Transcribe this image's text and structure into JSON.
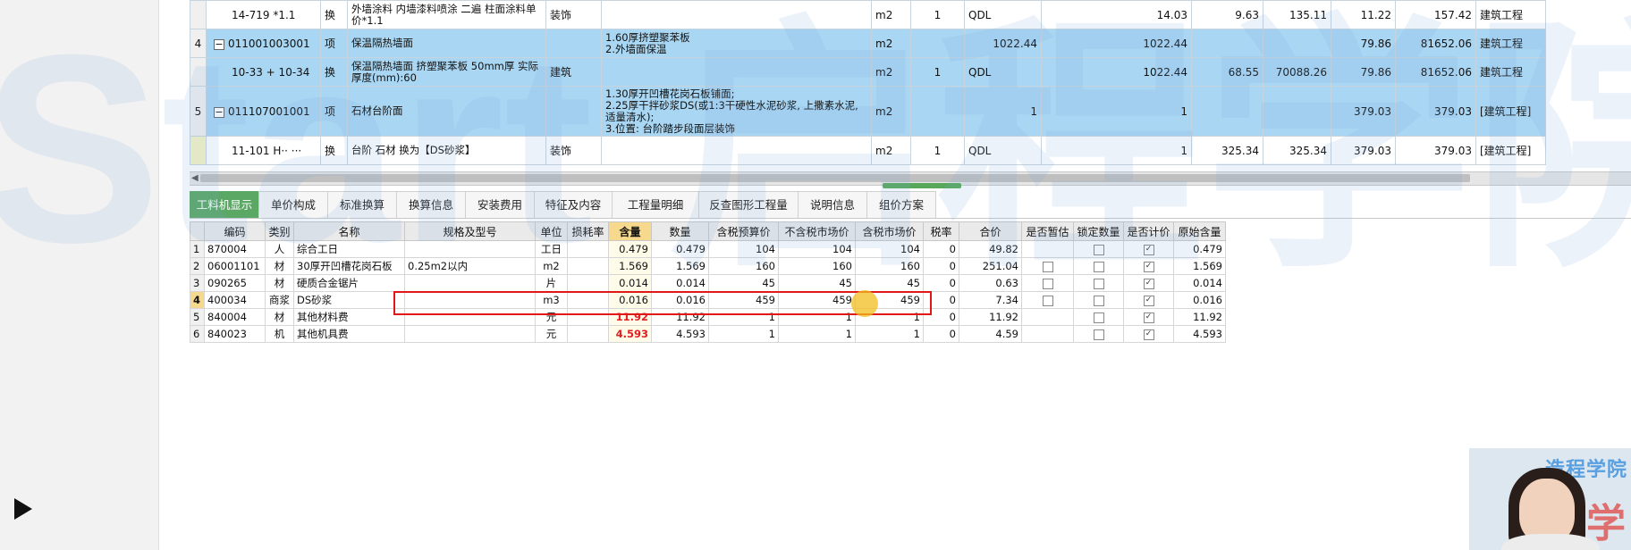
{
  "top_table": {
    "rows": [
      {
        "rowno": "",
        "code": "14-719 *1.1",
        "type": "换",
        "name": "外墙涂料 内墙漆料喷涂 二遍 柱面涂料单价*1.1",
        "profession": "装饰",
        "feature": "",
        "unit": "m2",
        "qty_ratio": "1",
        "expr": "QDL",
        "quantity": "14.03",
        "price": "9.63",
        "total": "135.11",
        "unit_price2": "11.22",
        "total2": "157.42",
        "category": "建筑工程"
      },
      {
        "rowno": "4",
        "code": "011001003001",
        "type": "项",
        "name": "保温隔热墙面",
        "profession": "",
        "feature": "1.60厚挤塑聚苯板\n2.外墙面保温",
        "unit": "m2",
        "qty_ratio": "",
        "expr": "1022.44",
        "quantity": "1022.44",
        "price": "",
        "total": "",
        "unit_price2": "79.86",
        "total2": "81652.06",
        "category": "建筑工程"
      },
      {
        "rowno": "",
        "code": "10-33 + 10-34",
        "type": "换",
        "name": "保温隔热墙面 挤塑聚苯板 50mm厚 实际厚度(mm):60",
        "profession": "建筑",
        "feature": "",
        "unit": "m2",
        "qty_ratio": "1",
        "expr": "QDL",
        "quantity": "1022.44",
        "price": "68.55",
        "total": "70088.26",
        "unit_price2": "79.86",
        "total2": "81652.06",
        "category": "建筑工程"
      },
      {
        "rowno": "5",
        "code": "011107001001",
        "type": "项",
        "name": "石材台阶面",
        "profession": "",
        "feature": "1.30厚开凹槽花岗石板铺面;\n2.25厚干拌砂浆DS(或1:3干硬性水泥砂浆, 上撒素水泥, 适量清水);\n3.位置: 台阶踏步段面层装饰",
        "unit": "m2",
        "qty_ratio": "",
        "expr": "1",
        "quantity": "1",
        "price": "",
        "total": "",
        "unit_price2": "379.03",
        "total2": "379.03",
        "category": "[建筑工程]"
      },
      {
        "rowno": "",
        "code": "11-101 H·· ···",
        "type": "换",
        "name": "台阶 石材 换为【DS砂浆】",
        "profession": "装饰",
        "feature": "",
        "unit": "m2",
        "qty_ratio": "1",
        "expr": "QDL",
        "quantity": "1",
        "price": "325.34",
        "total": "325.34",
        "unit_price2": "379.03",
        "total2": "379.03",
        "category": "[建筑工程]"
      }
    ]
  },
  "tabs": [
    "工料机显示",
    "单价构成",
    "标准换算",
    "换算信息",
    "安装费用",
    "特征及内容",
    "工程量明细",
    "反查图形工程量",
    "说明信息",
    "组价方案"
  ],
  "grid": {
    "headers": [
      "编码",
      "类别",
      "名称",
      "规格及型号",
      "单位",
      "损耗率",
      "含量",
      "数量",
      "含税预算价",
      "不含税市场价",
      "含税市场价",
      "税率",
      "合价",
      "是否暂估",
      "锁定数量",
      "是否计价",
      "原始含量"
    ],
    "rows": [
      {
        "n": "1",
        "code": "870004",
        "cat": "人",
        "name": "综合工日",
        "spec": "",
        "unit": "工日",
        "loss": "",
        "content": "0.479",
        "qty": "0.479",
        "p1": "104",
        "p2": "104",
        "p3": "104",
        "tax": "0",
        "total": "49.82",
        "est": "",
        "lock": "",
        "price": "✓",
        "orig": "0.479"
      },
      {
        "n": "2",
        "code": "06001101",
        "cat": "材",
        "name": "30厚开凹槽花岗石板",
        "spec": "0.25m2以内",
        "unit": "m2",
        "loss": "",
        "content": "1.569",
        "qty": "1.569",
        "p1": "160",
        "p2": "160",
        "p3": "160",
        "tax": "0",
        "total": "251.04",
        "est": "box",
        "lock": "",
        "price": "✓",
        "orig": "1.569"
      },
      {
        "n": "3",
        "code": "090265",
        "cat": "材",
        "name": "硬质合金锯片",
        "spec": "",
        "unit": "片",
        "loss": "",
        "content": "0.014",
        "qty": "0.014",
        "p1": "45",
        "p2": "45",
        "p3": "45",
        "tax": "0",
        "total": "0.63",
        "est": "box",
        "lock": "",
        "price": "✓",
        "orig": "0.014"
      },
      {
        "n": "4",
        "code": "400034",
        "cat": "商浆",
        "name": "DS砂浆",
        "spec": "",
        "unit": "m3",
        "loss": "",
        "content": "0.016",
        "qty": "0.016",
        "p1": "459",
        "p2": "459",
        "p3": "459",
        "tax": "0",
        "total": "7.34",
        "est": "box",
        "lock": "",
        "price": "✓",
        "orig": "0.016"
      },
      {
        "n": "5",
        "code": "840004",
        "cat": "材",
        "name": "其他材料费",
        "spec": "",
        "unit": "元",
        "loss": "",
        "content": "11.92",
        "qty": "11.92",
        "p1": "1",
        "p2": "1",
        "p3": "1",
        "tax": "0",
        "total": "11.92",
        "est": "",
        "lock": "",
        "price": "✓",
        "orig": "11.92"
      },
      {
        "n": "6",
        "code": "840023",
        "cat": "机",
        "name": "其他机具费",
        "spec": "",
        "unit": "元",
        "loss": "",
        "content": "4.593",
        "qty": "4.593",
        "p1": "1",
        "p2": "1",
        "p3": "1",
        "tax": "0",
        "total": "4.59",
        "est": "",
        "lock": "",
        "price": "✓",
        "orig": "4.593"
      }
    ]
  },
  "colors": {
    "active_tab": "#5aa864",
    "row_highlight": "#a9d6f2",
    "annotation": "#e01818",
    "header_highlight": "#f6d98c"
  },
  "webcam": {
    "bg_text_top": "造程学院",
    "bg_text_bottom": "广学"
  },
  "watermark": {
    "text": "Start 启程学院"
  }
}
